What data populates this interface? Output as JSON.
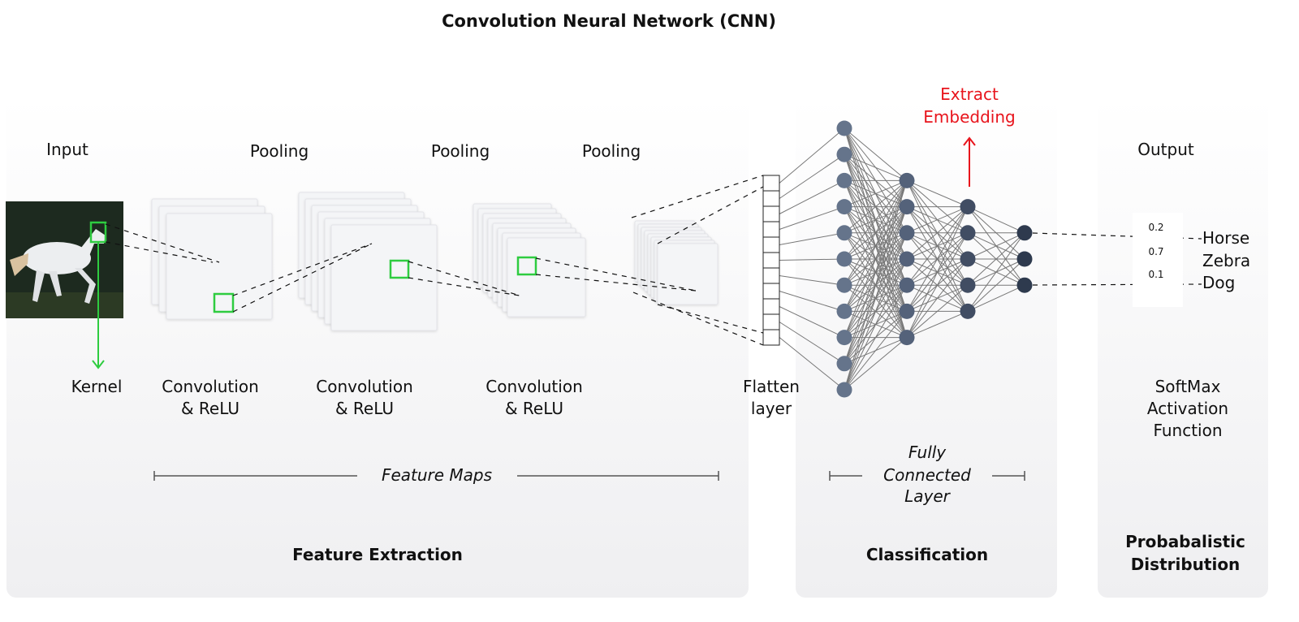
{
  "title": "Convolution Neural Network (CNN)",
  "input_label": "Input",
  "kernel_label": "Kernel",
  "pooling_labels": [
    "Pooling",
    "Pooling",
    "Pooling"
  ],
  "conv_labels": [
    [
      "Convolution",
      "& ReLU"
    ],
    [
      "Convolution",
      "& ReLU"
    ],
    [
      "Convolution",
      "& ReLU"
    ]
  ],
  "flatten_label": [
    "Flatten",
    "layer"
  ],
  "feature_maps_label": "Feature Maps",
  "fully_connected_label": [
    "Fully",
    "Connected",
    "Layer"
  ],
  "extract_embedding_label": [
    "Extract",
    "Embedding"
  ],
  "output_label": "Output",
  "probabilities": [
    "0.2",
    "0.7",
    "0.1"
  ],
  "classes": [
    "Horse",
    "Zebra",
    "Dog"
  ],
  "softmax_label": [
    "SoftMax",
    "Activation",
    "Function"
  ],
  "sections": {
    "feature_extraction": "Feature Extraction",
    "classification": "Classification",
    "probabilistic": [
      "Probabalistic",
      "Distribution"
    ]
  },
  "network_layers": [
    11,
    7,
    5,
    3
  ],
  "flatten_cells": 11,
  "colors": {
    "kernel": "#2ecc40",
    "embedding": "#e8141c",
    "node_colors": [
      "#65748b",
      "#54627a",
      "#414d63",
      "#2e3a4e"
    ]
  }
}
